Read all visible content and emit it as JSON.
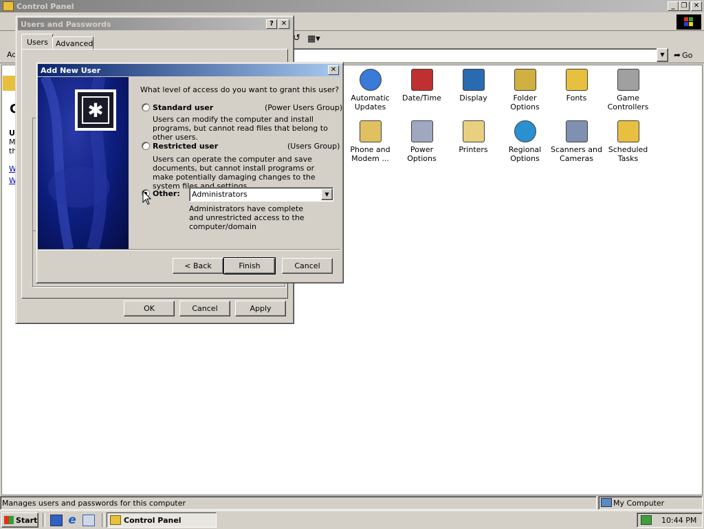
{
  "control_panel": {
    "title": "Control Panel",
    "address_label": "Ad",
    "go_label": "Go",
    "left_heading_initial": "C",
    "left_text_initials": [
      "U",
      "M",
      "th"
    ],
    "left_links": [
      "W",
      "W"
    ],
    "status_text": "Manages users and passwords for this computer",
    "status_zone": "My Computer",
    "icons": [
      {
        "name": "automatic-updates-icon",
        "label": "Automatic Updates"
      },
      {
        "name": "date-time-icon",
        "label": "Date/Time"
      },
      {
        "name": "display-icon",
        "label": "Display"
      },
      {
        "name": "folder-options-icon",
        "label": "Folder Options"
      },
      {
        "name": "fonts-icon",
        "label": "Fonts"
      },
      {
        "name": "game-controllers-icon",
        "label": "Game Controllers"
      },
      {
        "name": "phone-modem-icon",
        "label": "Phone and Modem ..."
      },
      {
        "name": "power-options-icon",
        "label": "Power Options"
      },
      {
        "name": "printers-icon",
        "label": "Printers"
      },
      {
        "name": "regional-options-icon",
        "label": "Regional Options"
      },
      {
        "name": "scanners-cameras-icon",
        "label": "Scanners and Cameras"
      },
      {
        "name": "scheduled-tasks-icon",
        "label": "Scheduled Tasks"
      }
    ]
  },
  "users_passwords": {
    "title": "Users and Passwords",
    "tabs": [
      "Users",
      "Advanced"
    ],
    "ok": "OK",
    "cancel": "Cancel",
    "apply": "Apply"
  },
  "add_user": {
    "title": "Add New User",
    "question": "What level of access do you want to grant this user?",
    "standard_label": "Standard user",
    "standard_group": "(Power Users Group)",
    "standard_desc": "Users can modify the computer and install programs, but cannot read files that belong to other users.",
    "restricted_label": "Restricted user",
    "restricted_group": "(Users Group)",
    "restricted_desc": "Users can operate the computer and save documents, but cannot install programs or make potentially damaging changes to the system files and settings.",
    "other_label": "Other:",
    "other_value": "Administrators",
    "other_desc": "Administrators have complete and unrestricted access to the computer/domain",
    "back": "< Back",
    "finish": "Finish",
    "cancel": "Cancel"
  },
  "taskbar": {
    "start": "Start",
    "task": "Control Panel",
    "clock": "10:44 PM"
  },
  "colors": {
    "title_active": "#0a246a",
    "desktop_face": "#d4d0c8",
    "wizard_banner": "#0c1c7a"
  }
}
